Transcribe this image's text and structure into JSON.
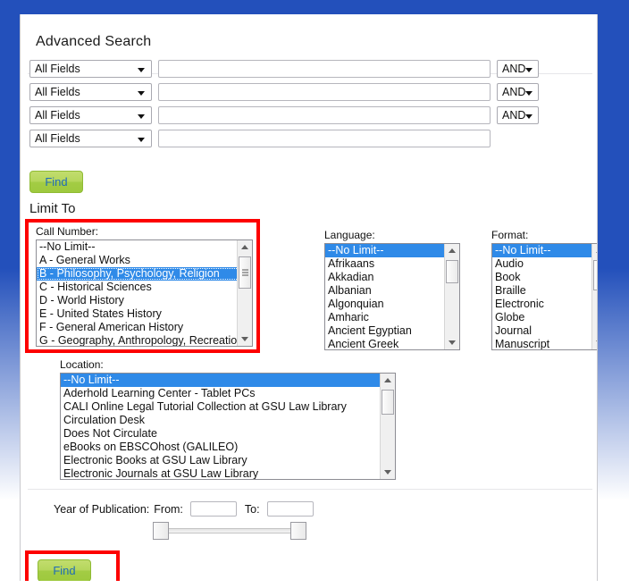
{
  "page": {
    "title": "Advanced Search",
    "limit_to_label": "Limit To"
  },
  "search": {
    "rows": [
      {
        "field": "All Fields",
        "value": "",
        "operator": "AND"
      },
      {
        "field": "All Fields",
        "value": "",
        "operator": "AND"
      },
      {
        "field": "All Fields",
        "value": "",
        "operator": "AND"
      },
      {
        "field": "All Fields",
        "value": ""
      }
    ],
    "find_label": "Find"
  },
  "limits": {
    "call_number": {
      "label": "Call Number:",
      "selected": "B - Philosophy, Psychology, Religion",
      "options": [
        "--No Limit--",
        "A - General Works",
        "B - Philosophy, Psychology, Religion",
        "C - Historical Sciences",
        "D - World History",
        "E - United States History",
        "F - General American History",
        "G - Geography, Anthropology, Recreation"
      ]
    },
    "language": {
      "label": "Language:",
      "selected": "--No Limit--",
      "options": [
        "--No Limit--",
        "Afrikaans",
        "Akkadian",
        "Albanian",
        "Algonquian",
        "Amharic",
        "Ancient Egyptian",
        "Ancient Greek"
      ]
    },
    "format": {
      "label": "Format:",
      "selected": "--No Limit--",
      "options": [
        "--No Limit--",
        "Audio",
        "Book",
        "Braille",
        "Electronic",
        "Globe",
        "Journal",
        "Manuscript"
      ]
    },
    "location": {
      "label": "Location:",
      "selected": "--No Limit--",
      "options": [
        "--No Limit--",
        "Aderhold Learning Center - Tablet PCs",
        "CALI Online Legal Tutorial Collection at GSU Law Library",
        "Circulation Desk",
        "Does Not Circulate",
        "eBooks on EBSCOhost (GALILEO)",
        "Electronic Books at GSU Law Library",
        "Electronic Journals at GSU Law Library"
      ]
    }
  },
  "year": {
    "label": "Year of Publication:",
    "from_label": "From:",
    "from_value": "",
    "to_label": "To:",
    "to_value": ""
  },
  "footer": {
    "find_label": "Find"
  },
  "colors": {
    "frame_blue": "#2350bb",
    "highlight_red": "#fd0000",
    "selection_blue": "#2f8ae8",
    "button_green": "#a3cc44",
    "button_text_blue": "#1f6bb8"
  }
}
